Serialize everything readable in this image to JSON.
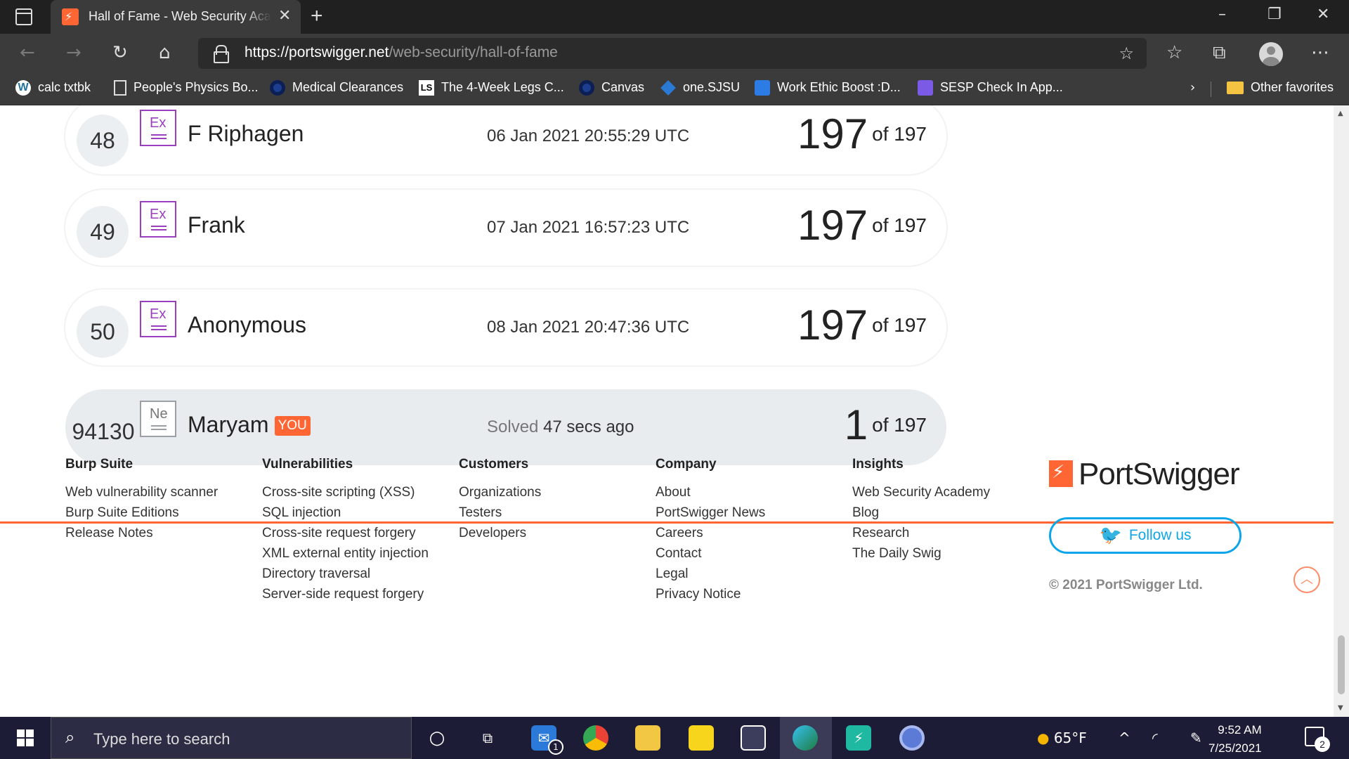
{
  "browser": {
    "tab_title": "Hall of Fame - Web Security Academy",
    "url_host": "https://portswigger.net",
    "url_path": "/web-security/hall-of-fame",
    "bookmarks": [
      {
        "label": "calc txtbk",
        "icon": "wordpress-icon"
      },
      {
        "label": "People's Physics Bo...",
        "icon": "document-icon"
      },
      {
        "label": "Medical Clearances",
        "icon": "circle-icon"
      },
      {
        "label": "The 4-Week Legs C...",
        "icon": "ls-icon"
      },
      {
        "label": "Canvas",
        "icon": "circle-icon"
      },
      {
        "label": "one.SJSU",
        "icon": "sjsu-icon"
      },
      {
        "label": "Work Ethic Boost :D...",
        "icon": "trello-icon"
      },
      {
        "label": "SESP Check In App...",
        "icon": "form-icon"
      }
    ],
    "other_favorites": "Other favorites"
  },
  "leaderboard": [
    {
      "rank": "48",
      "badge": "Ex",
      "name": "F Riphagen",
      "time": "06 Jan 2021 20:55:29 UTC",
      "solved": "197",
      "total": "of 197"
    },
    {
      "rank": "49",
      "badge": "Ex",
      "name": "Frank",
      "time": "07 Jan 2021 16:57:23 UTC",
      "solved": "197",
      "total": "of 197"
    },
    {
      "rank": "50",
      "badge": "Ex",
      "name": "Anonymous",
      "time": "08 Jan 2021 20:47:36 UTC",
      "solved": "197",
      "total": "of 197"
    }
  ],
  "current_user": {
    "rank": "94130",
    "badge": "Ne",
    "name": "Maryam",
    "you_label": "YOU",
    "solved_label": "Solved",
    "solved_ago": "47 secs ago",
    "solved": "1",
    "total": "of 197"
  },
  "footer": {
    "columns": [
      {
        "title": "Burp Suite",
        "links": [
          "Web vulnerability scanner",
          "Burp Suite Editions",
          "Release Notes"
        ]
      },
      {
        "title": "Vulnerabilities",
        "links": [
          "Cross-site scripting (XSS)",
          "SQL injection",
          "Cross-site request forgery",
          "XML external entity injection",
          "Directory traversal",
          "Server-side request forgery"
        ]
      },
      {
        "title": "Customers",
        "links": [
          "Organizations",
          "Testers",
          "Developers"
        ]
      },
      {
        "title": "Company",
        "links": [
          "About",
          "PortSwigger News",
          "Careers",
          "Contact",
          "Legal",
          "Privacy Notice"
        ]
      },
      {
        "title": "Insights",
        "links": [
          "Web Security Academy",
          "Blog",
          "Research",
          "The Daily Swig"
        ]
      }
    ],
    "brand": "PortSwigger",
    "follow_label": "Follow us",
    "copyright": "© 2021 PortSwigger Ltd."
  },
  "taskbar": {
    "search_placeholder": "Type here to search",
    "mail_badge": "1",
    "weather": "65°F",
    "time": "9:52 AM",
    "date": "7/25/2021",
    "notifications": "2"
  },
  "colors": {
    "accent": "#ff6633",
    "badge_expert": "#9b3fbf",
    "twitter": "#0ea5e9"
  }
}
